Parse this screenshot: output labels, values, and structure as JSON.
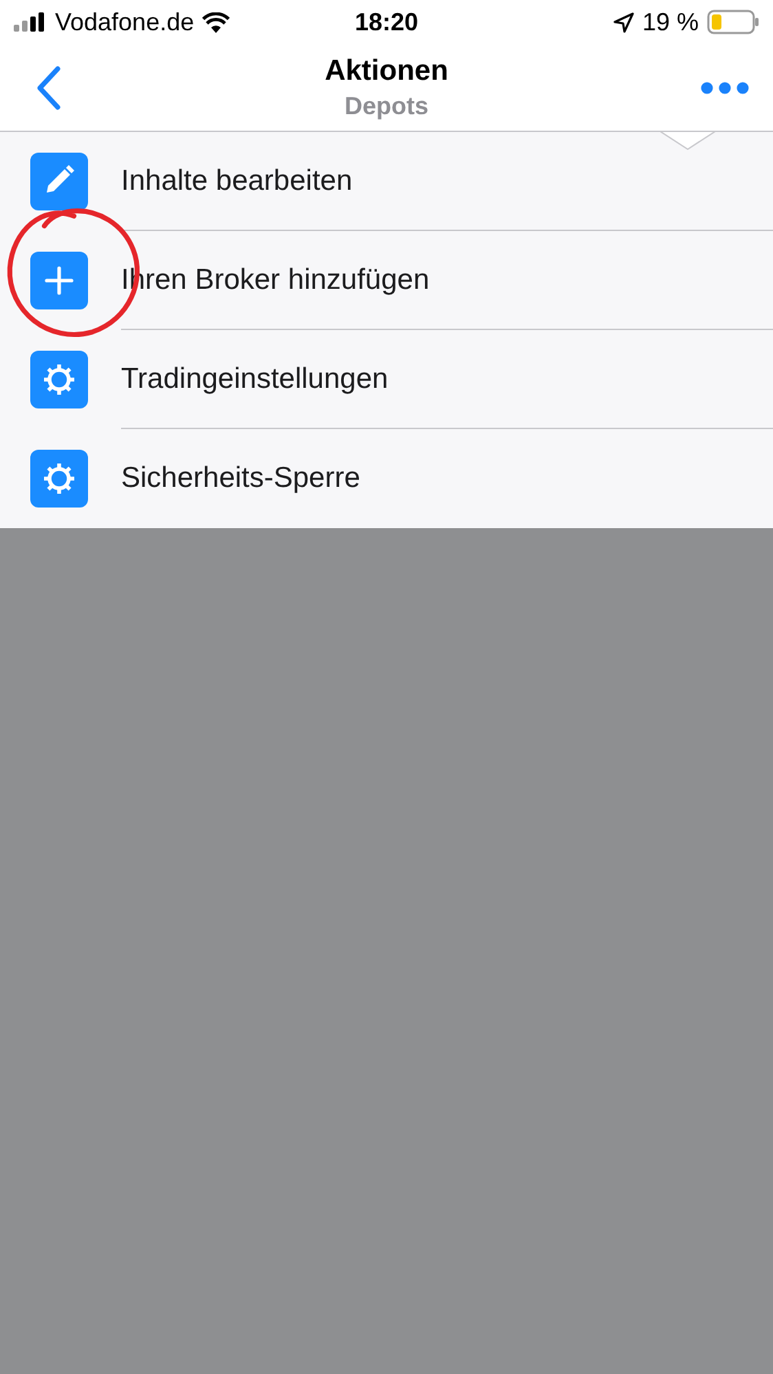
{
  "status_bar": {
    "carrier": "Vodafone.de",
    "time": "18:20",
    "battery": "19 %"
  },
  "nav": {
    "title": "Aktionen",
    "subtitle": "Depots"
  },
  "menu": [
    {
      "kind": "edit",
      "label": "Inhalte bearbeiten"
    },
    {
      "kind": "add",
      "label": "Ihren Broker hinzufügen"
    },
    {
      "kind": "settings",
      "label": "Tradingeinstellungen"
    },
    {
      "kind": "settings",
      "label": "Sicherheits-Sperre"
    }
  ]
}
